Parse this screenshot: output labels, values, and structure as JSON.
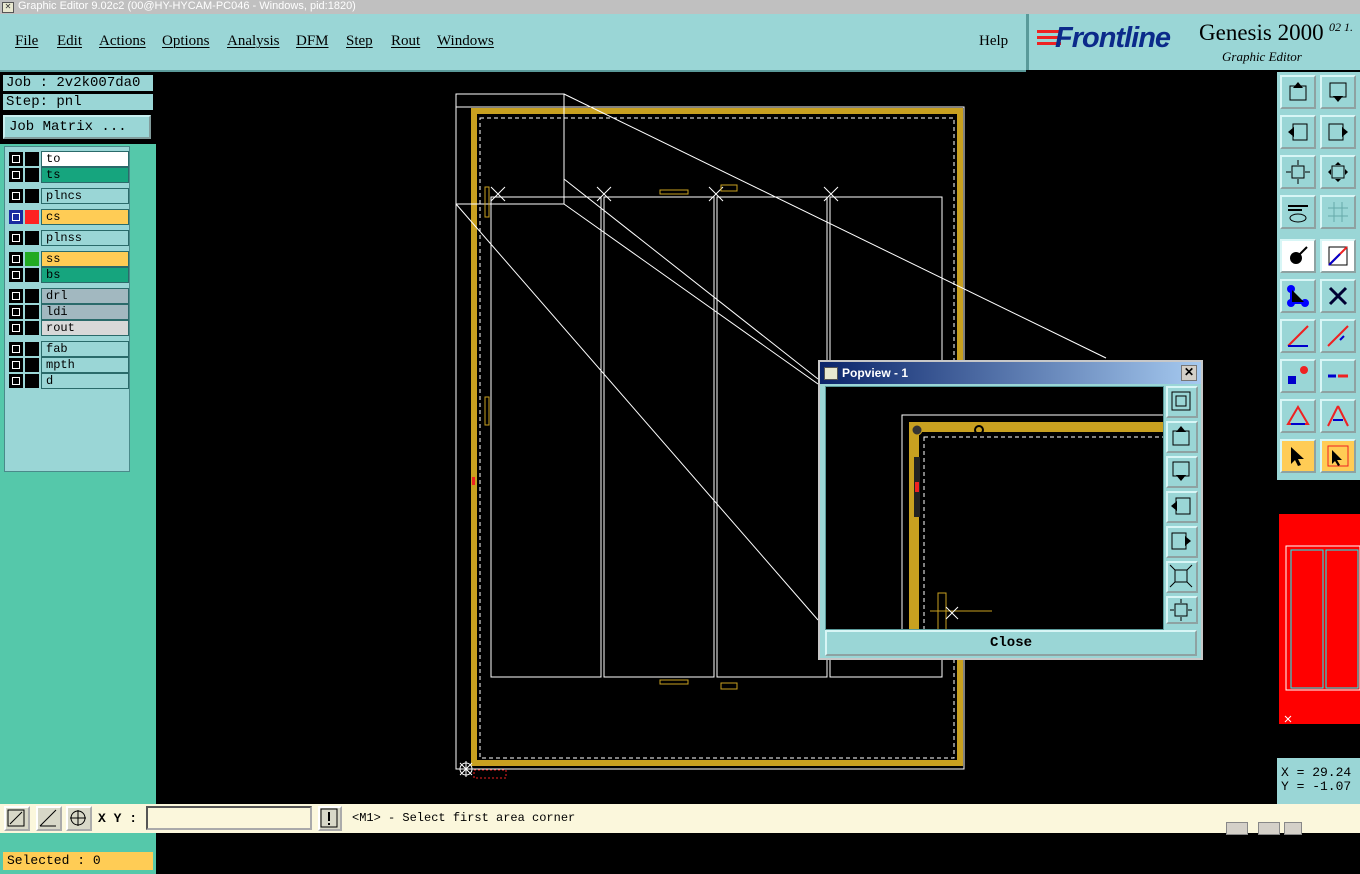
{
  "window": {
    "title": "Graphic Editor 9.02c2 (00@HY-HYCAM-PC046 - Windows, pid:1820)"
  },
  "menu": {
    "items": [
      "File",
      "Edit",
      "Actions",
      "Options",
      "Analysis",
      "DFM",
      "Step",
      "Rout",
      "Windows"
    ],
    "help": "Help"
  },
  "logo": {
    "brand": "Frontline",
    "product": "Genesis 2000",
    "subtitle": "Graphic Editor",
    "version": "02 1."
  },
  "job": {
    "job_line": "Job : 2v2k007da0",
    "step_line": "Step: pnl",
    "matrix_button": "Job Matrix ..."
  },
  "layers": [
    {
      "name": "to",
      "bg": "#ffffff",
      "color": "#000000"
    },
    {
      "name": "ts",
      "bg": "#16a57e",
      "color": "#000000"
    },
    {
      "name": "plncs",
      "bg": "#9ad6d6",
      "color": "#000000"
    },
    {
      "name": "cs",
      "bg": "#ffcc55",
      "color": "#ff2222",
      "active": true
    },
    {
      "name": "plnss",
      "bg": "#9ad6d6",
      "color": "#000000"
    },
    {
      "name": "ss",
      "bg": "#ffcc55",
      "color": "#22aa22"
    },
    {
      "name": "bs",
      "bg": "#16a57e",
      "color": "#000000"
    },
    {
      "name": "drl",
      "bg": "#a2b8c0",
      "color": "#000000"
    },
    {
      "name": "ldi",
      "bg": "#a2b8c0",
      "color": "#000000"
    },
    {
      "name": "rout",
      "bg": "#d8d8d8",
      "color": "#000000"
    },
    {
      "name": "fab",
      "bg": "#9ad6d6",
      "color": "#000000"
    },
    {
      "name": "mpth",
      "bg": "#9ad6d6",
      "color": "#000000"
    },
    {
      "name": "d",
      "bg": "#9ad6d6",
      "color": "#000000"
    }
  ],
  "selected": "Selected : 0",
  "coords": {
    "x": "X = 29.24",
    "y": "Y = -1.07"
  },
  "bottom": {
    "xy_label": "X Y :",
    "xy_value": "",
    "status": "<M1> - Select first area corner"
  },
  "popview": {
    "title": "Popview - 1",
    "close_label": "Close"
  },
  "colors": {
    "panel": "#9ad6d6",
    "layer_panel": "#55c8aa",
    "board_outline": "#c8a020",
    "selected_bg": "#ffcc55",
    "minimap_fill": "#ff0000"
  }
}
